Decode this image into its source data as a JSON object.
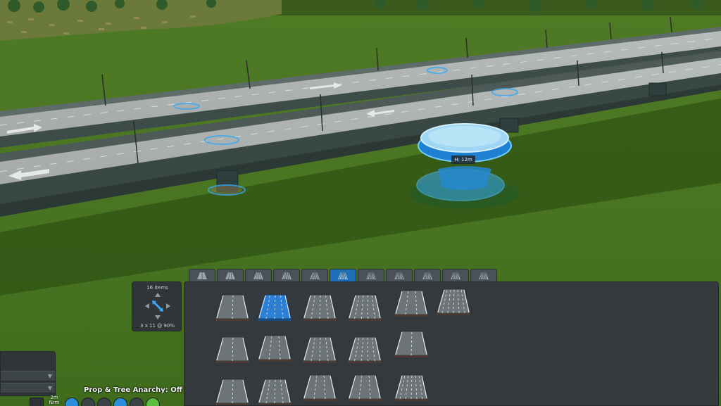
{
  "viewport": {
    "elevation_tag": "H: 12m"
  },
  "tabs": [
    {
      "name": "tab-two-lane-roads",
      "icon": "two-lane-road-icon",
      "active": false
    },
    {
      "name": "tab-four-lane-roads",
      "icon": "four-lane-road-icon",
      "active": false
    },
    {
      "name": "tab-six-lane-roads",
      "icon": "six-lane-road-icon",
      "active": false
    },
    {
      "name": "tab-eight-lane-roads",
      "icon": "eight-lane-road-icon",
      "active": false
    },
    {
      "name": "tab-wide-roads",
      "icon": "wide-road-icon",
      "active": false
    },
    {
      "name": "tab-highways",
      "icon": "highway-icon",
      "active": true
    },
    {
      "name": "tab-intersections",
      "icon": "intersection-icon",
      "active": false
    },
    {
      "name": "tab-public-transport",
      "icon": "bus-icon",
      "active": false
    },
    {
      "name": "tab-pedestrian",
      "icon": "pedestrian-icon",
      "active": false
    },
    {
      "name": "tab-decoration",
      "icon": "decoration-icon",
      "active": false
    },
    {
      "name": "tab-tools",
      "icon": "tools-icon",
      "active": false
    }
  ],
  "scroll_widget": {
    "count_label": "16 items",
    "grid_label": "3 x 11 @ 90%"
  },
  "status": {
    "anarchy": "Prop & Tree Anarchy: Off",
    "elevation_step": "2m",
    "elevation_mode": "Nrm"
  },
  "colors": {
    "grass": "#3e6a1c",
    "panel": "#33393d",
    "accent": "#1d6fb8",
    "highlight": "#3aa8f0"
  }
}
